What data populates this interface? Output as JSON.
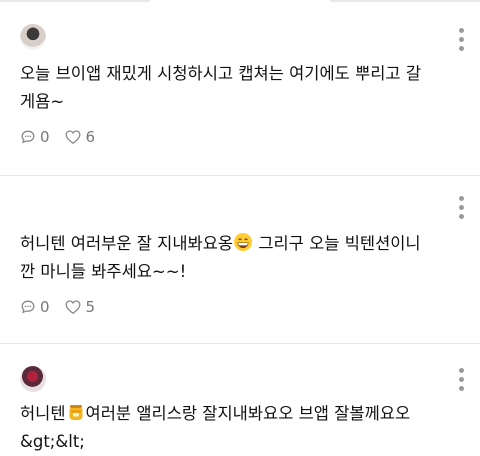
{
  "comments": [
    {
      "text": "오늘 브이앱 재밌게 시청하시고 캡쳐는 여기에도 뿌리고 갈\n게욤~",
      "comment_count": "0",
      "like_count": "6",
      "avatar_icon": "user-avatar-icon"
    },
    {
      "text_before_emoji": "허니텐 여러부운 잘 지내봐요옹",
      "emoji": "grinning-face-emoji",
      "text_after_emoji": " 그리구 오늘 빅텐션이니\n깐 마니들 봐주세요~~!",
      "comment_count": "0",
      "like_count": "5"
    },
    {
      "text_before_emoji": "허니텐",
      "emoji": "honey-pot-emoji",
      "text_after_emoji": "여러분 앨리스랑 잘지내봐요오 브앱 잘볼께요오\n&gt;&lt;",
      "avatar_icon": "user-avatar-icon"
    }
  ],
  "colors": {
    "text": "#111111",
    "meta": "#777777",
    "divider": "#e6e6e6",
    "menu_dots": "#9a9a9a"
  }
}
